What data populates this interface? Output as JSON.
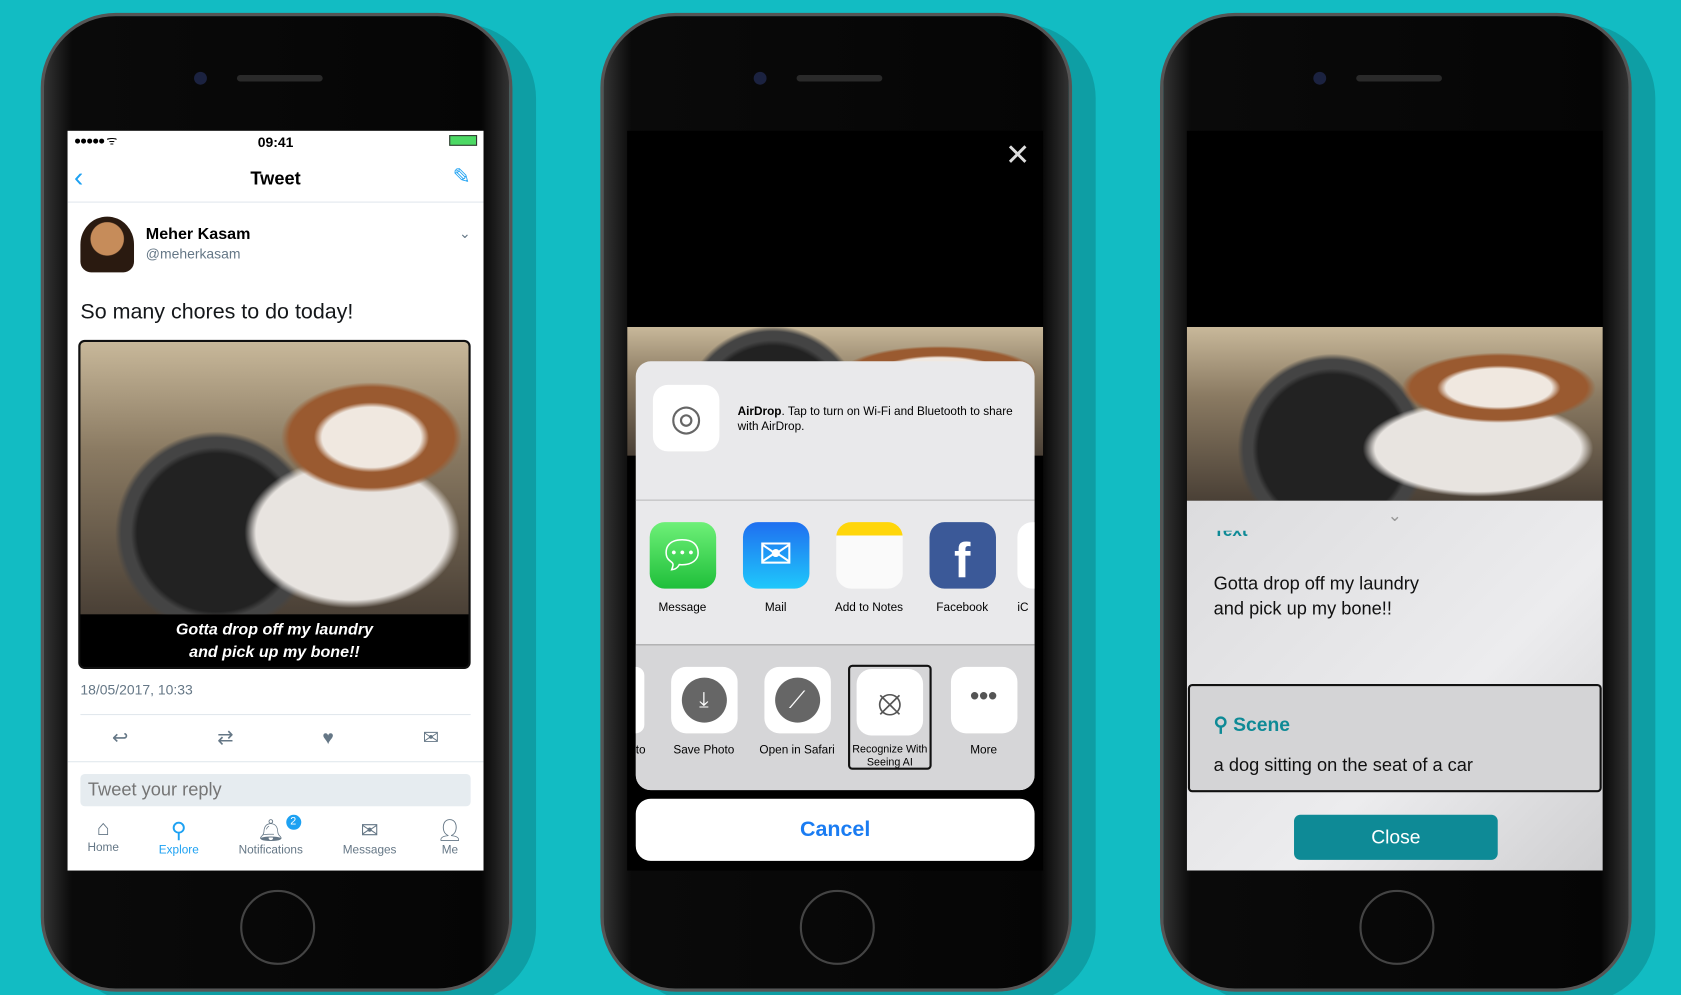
{
  "phone1": {
    "status": {
      "time": "09:41"
    },
    "nav": {
      "title": "Tweet"
    },
    "tweet": {
      "name": "Meher Kasam",
      "handle": "@meherkasam",
      "text": "So many chores to do today!",
      "caption_line1": "Gotta drop off my laundry",
      "caption_line2": "and pick up my bone!!",
      "timestamp": "18/05/2017, 10:33"
    },
    "reply": {
      "placeholder": "Tweet your reply"
    },
    "tabs": [
      {
        "label": "Home",
        "icon": "home-icon"
      },
      {
        "label": "Explore",
        "icon": "search-icon",
        "active": true
      },
      {
        "label": "Notifications",
        "icon": "bell-icon",
        "badge": "2"
      },
      {
        "label": "Messages",
        "icon": "envelope-icon"
      },
      {
        "label": "Me",
        "icon": "person-icon"
      }
    ],
    "accent": "#1da1f2"
  },
  "phone2": {
    "airdrop": {
      "title": "AirDrop",
      "text": ". Tap to turn on Wi-Fi and Bluetooth to share with AirDrop."
    },
    "apps": [
      {
        "label": "Message",
        "color": "#34c759"
      },
      {
        "label": "Mail",
        "color": "#1e8cf5"
      },
      {
        "label": "Add to Notes",
        "color": "#ffd60a"
      },
      {
        "label": "Facebook",
        "color": "#3b5998"
      },
      {
        "label": "iC"
      }
    ],
    "actions": [
      {
        "label": "to"
      },
      {
        "label": "Save Photo"
      },
      {
        "label": "Open in Safari"
      },
      {
        "label": "Recognize With Seeing AI"
      },
      {
        "label": "More"
      }
    ],
    "cancel": "Cancel"
  },
  "phone3": {
    "text_section": {
      "heading": "Text",
      "content_line1": "Gotta drop off my laundry",
      "content_line2": "and pick up my bone!!"
    },
    "scene_section": {
      "heading": "Scene",
      "content": "a dog sitting on the seat of a car"
    },
    "close": "Close",
    "accent": "#0e8a96"
  }
}
